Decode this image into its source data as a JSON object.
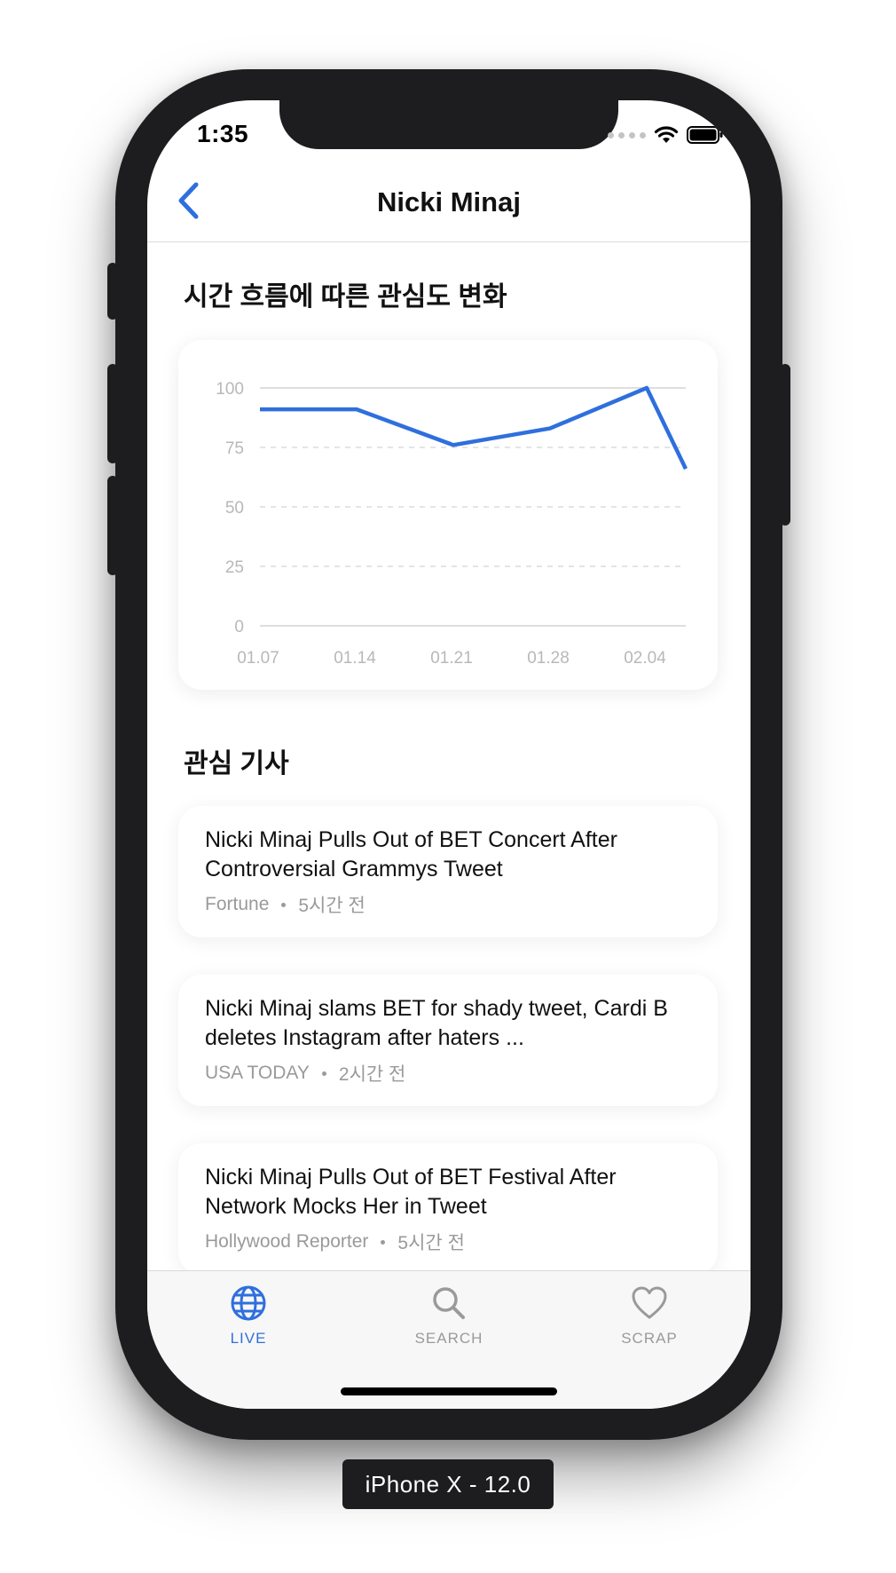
{
  "status_bar": {
    "time": "1:35"
  },
  "navbar": {
    "title": "Nicki Minaj"
  },
  "chart_section": {
    "title": "시간 흐름에 따른 관심도 변화"
  },
  "chart_data": {
    "type": "line",
    "x": [
      "01.07",
      "01.14",
      "01.21",
      "01.28",
      "02.04"
    ],
    "series": [
      {
        "values": [
          91,
          91,
          76,
          83,
          100,
          66
        ]
      }
    ],
    "yticks": [
      100,
      75,
      50,
      25,
      0
    ],
    "ylim": [
      0,
      100
    ],
    "grid": "horizontal dashed",
    "line_color": "#2f6fdd"
  },
  "articles_section": {
    "title": "관심 기사"
  },
  "articles": [
    {
      "title_line1": "Nicki Minaj Pulls Out of BET Concert After",
      "title_line2": "Controversial Grammys Tweet",
      "source": "Fortune",
      "time": "5시간 전"
    },
    {
      "title_line1": "Nicki Minaj slams BET for shady tweet, Cardi B",
      "title_line2": "deletes Instagram after haters ...",
      "source": "USA TODAY",
      "time": "2시간 전"
    },
    {
      "title_line1": "Nicki Minaj Pulls Out of BET Festival After",
      "title_line2": "Network Mocks Her in Tweet",
      "source": "Hollywood Reporter",
      "time": "5시간 전"
    }
  ],
  "tabbar": {
    "tabs": [
      {
        "label": "LIVE",
        "icon": "globe-icon",
        "active": true
      },
      {
        "label": "SEARCH",
        "icon": "search-icon",
        "active": false
      },
      {
        "label": "SCRAP",
        "icon": "heart-icon",
        "active": false
      }
    ]
  },
  "colors": {
    "accent": "#2f6fdd",
    "inactive": "#9a9a9a"
  },
  "device_label": "iPhone X - 12.0"
}
